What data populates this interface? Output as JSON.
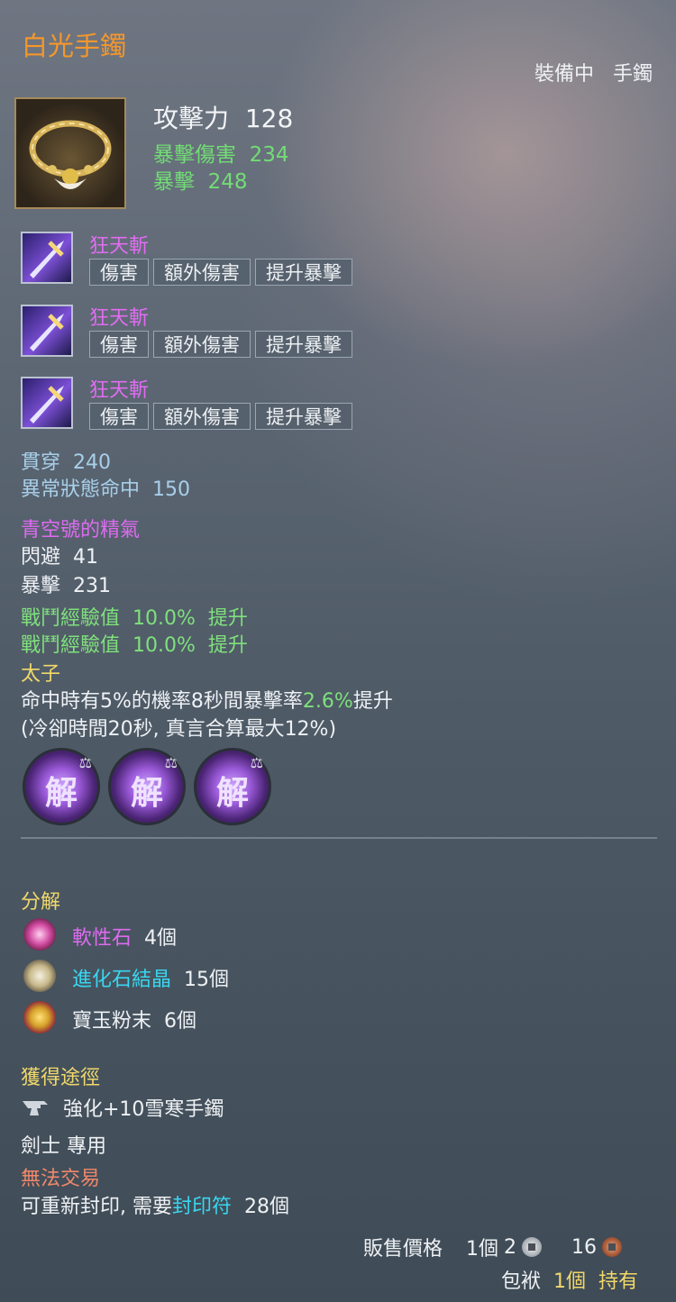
{
  "item": {
    "name": "白光手鐲",
    "equip_state": "裝備中",
    "slot": "手鐲",
    "attack_label": "攻擊力",
    "attack_value": "128",
    "sub_stats": [
      {
        "label": "暴擊傷害",
        "value": "234"
      },
      {
        "label": "暴擊",
        "value": "248"
      }
    ]
  },
  "skills": [
    {
      "name": "狂天斬",
      "tags": [
        "傷害",
        "額外傷害",
        "提升暴擊"
      ]
    },
    {
      "name": "狂天斬",
      "tags": [
        "傷害",
        "額外傷害",
        "提升暴擊"
      ]
    },
    {
      "name": "狂天斬",
      "tags": [
        "傷害",
        "額外傷害",
        "提升暴擊"
      ]
    }
  ],
  "extra_stats": [
    {
      "label": "貫穿",
      "value": "240"
    },
    {
      "label": "異常狀態命中",
      "value": "150"
    }
  ],
  "set_bonus": {
    "name": "青空號的精氣",
    "stats": [
      {
        "label": "閃避",
        "value": "41"
      },
      {
        "label": "暴擊",
        "value": "231"
      }
    ],
    "exp_bonus": [
      {
        "label": "戰鬥經驗值",
        "value": "10.0%",
        "suffix": "提升"
      },
      {
        "label": "戰鬥經驗值",
        "value": "10.0%",
        "suffix": "提升"
      }
    ]
  },
  "effect": {
    "name": "太子",
    "desc_pre": "命中時有5%的機率8秒間暴擊率",
    "desc_value": "2.6%",
    "desc_post": "提升",
    "desc2": "(冷卻時間20秒, 真言合算最大12%)"
  },
  "gems": [
    {
      "glyph": "解",
      "icon": "gem-icon"
    },
    {
      "glyph": "解",
      "icon": "gem-icon"
    },
    {
      "glyph": "解",
      "icon": "gem-icon"
    }
  ],
  "decompose": {
    "title": "分解",
    "materials": [
      {
        "name": "軟性石",
        "count": "4個",
        "icon": "soft-stone-icon",
        "color": "#de6bf0"
      },
      {
        "name": "進化石結晶",
        "count": "15個",
        "icon": "evolution-crystal-icon",
        "color": "#3ad6f0"
      },
      {
        "name": "寶玉粉末",
        "count": "6個",
        "icon": "jade-powder-icon",
        "color": "#eef1f4"
      }
    ]
  },
  "acquire": {
    "title": "獲得途徑",
    "method": "強化+10雪寒手鐲",
    "method_icon": "anvil-icon"
  },
  "class_restriction": "劍士  專用",
  "trade": {
    "status": "無法交易",
    "reseal_pre": "可重新封印, 需要",
    "reseal_item": "封印符",
    "reseal_count": "28個"
  },
  "sell": {
    "label": "販售價格",
    "unit": "1個",
    "silver": "2",
    "copper": "16"
  },
  "inventory": {
    "label": "包袱",
    "count": "1個",
    "status": "持有"
  }
}
